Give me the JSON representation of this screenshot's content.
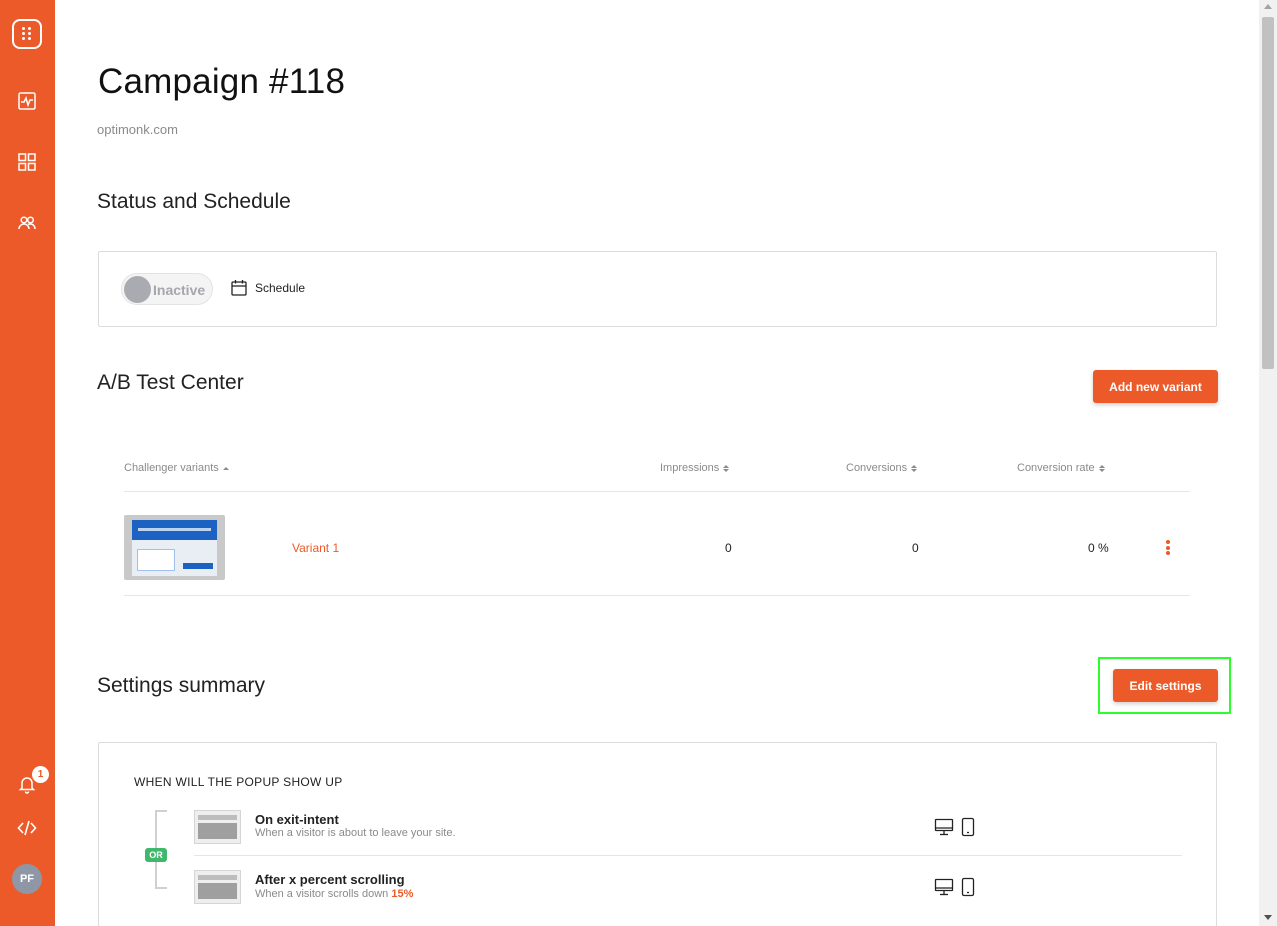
{
  "sidebar": {
    "notification_count": "1",
    "avatar_initials": "PF",
    "accent_color": "#ed5a29"
  },
  "page": {
    "title": "Campaign #118",
    "domain": "optimonk.com"
  },
  "status_section": {
    "title": "Status and Schedule",
    "toggle_label": "Inactive",
    "schedule_label": "Schedule"
  },
  "ab_section": {
    "title": "A/B Test Center",
    "add_button": "Add new variant",
    "columns": [
      "Challenger variants",
      "Impressions",
      "Conversions",
      "Conversion rate"
    ],
    "rows": [
      {
        "name": "Variant 1",
        "impressions": "0",
        "conversions": "0",
        "conversion_rate": "0 %"
      }
    ]
  },
  "settings_section": {
    "title": "Settings summary",
    "edit_button": "Edit settings",
    "when_title": "WHEN WILL THE POPUP SHOW UP",
    "or_label": "OR",
    "triggers": [
      {
        "title": "On exit-intent",
        "desc": "When a visitor is about to leave your site.",
        "desc_value": ""
      },
      {
        "title": "After x percent scrolling",
        "desc": "When a visitor scrolls down",
        "desc_value": "15%"
      }
    ]
  }
}
